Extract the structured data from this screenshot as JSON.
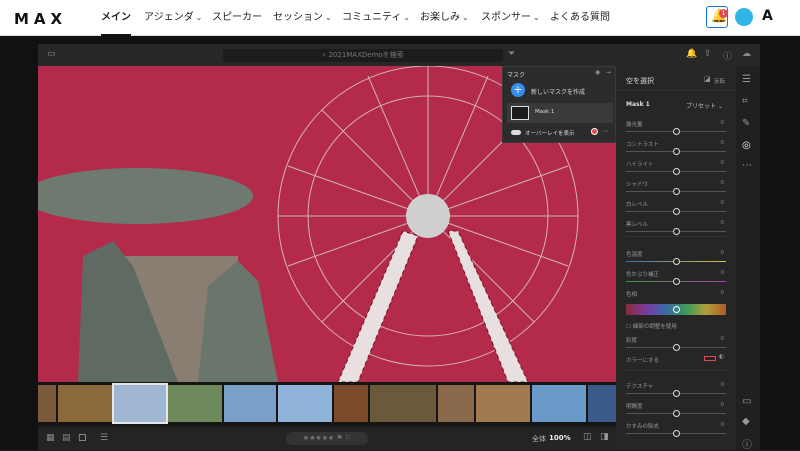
{
  "nav": {
    "logo": "MAX",
    "items": [
      {
        "label": "メイン",
        "chev": ""
      },
      {
        "label": "アジェンダ",
        "chev": "⌄"
      },
      {
        "label": "スピーカー",
        "chev": ""
      },
      {
        "label": "セッション",
        "chev": "⌄"
      },
      {
        "label": "コミュニティ",
        "chev": "⌄"
      },
      {
        "label": "お楽しみ",
        "chev": "⌄"
      },
      {
        "label": "スポンサー",
        "chev": "⌄"
      },
      {
        "label": "よくある質問",
        "chev": ""
      }
    ],
    "notif_count": "1",
    "adobe_logo": "A",
    "accent": "#1473e6"
  },
  "app": {
    "search_placeholder": "2021MAXDemoを検索",
    "icons": [
      "panel-toggle-icon",
      "search-icon",
      "filter-icon",
      "bell-icon",
      "share-icon",
      "help-icon",
      "cloud-icon"
    ]
  },
  "mask": {
    "title": "マスク",
    "create_label": "新しいマスクを作成",
    "item_label": "Mask 1",
    "overlay_label": "オーバーレイを表示",
    "overlay_color": "#e34850"
  },
  "panel": {
    "title": "空を選択",
    "invert_label": "反転",
    "mask_name": "Mask 1",
    "preset_label": "プリセット",
    "sliders": [
      {
        "label": "露光量",
        "value": "0"
      },
      {
        "label": "コントラスト",
        "value": "0"
      },
      {
        "label": "ハイライト",
        "value": "0"
      },
      {
        "label": "シャドウ",
        "value": "0"
      },
      {
        "label": "白レベル",
        "value": "0"
      },
      {
        "label": "黒レベル",
        "value": "0"
      },
      {
        "label": "色温度",
        "value": "0"
      },
      {
        "label": "色かぶり補正",
        "value": "0"
      },
      {
        "label": "色相",
        "value": "0"
      }
    ],
    "fine_adjust_label": "細部の調整を使用",
    "saturation_label": "彩度",
    "saturation_value": "0",
    "colorize_label": "カラーにする",
    "sliders2": [
      {
        "label": "テクスチャ",
        "value": "0"
      },
      {
        "label": "明瞭度",
        "value": "0"
      },
      {
        "label": "かすみの除去",
        "value": "0"
      }
    ]
  },
  "bottom": {
    "view_label": "全体",
    "zoom": "100%",
    "stars": "★★★★★",
    "flags": "⚑ ⚐"
  },
  "photo": {
    "sky_color": "#b32a4a"
  }
}
